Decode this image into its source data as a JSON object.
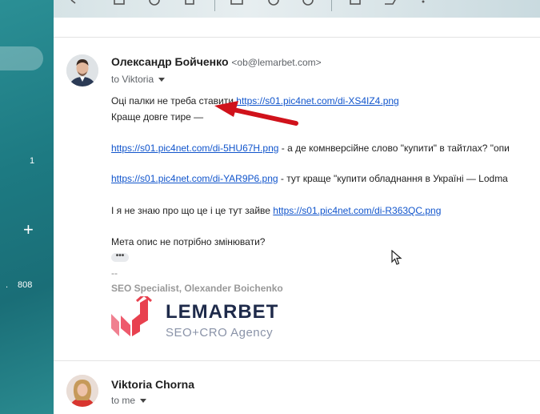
{
  "sidebar": {
    "counts": [
      "1",
      "808"
    ],
    "compose_plus": "+",
    "dot": "."
  },
  "toolbar": {
    "icons": [
      "back-arrow-icon",
      "archive-icon",
      "report-spam-icon",
      "delete-icon",
      "mark-unread-icon",
      "snooze-icon",
      "add-task-icon",
      "move-to-icon",
      "label-icon",
      "more-icon"
    ]
  },
  "message1": {
    "sender_name": "Олександр Бойченко",
    "sender_email": "<ob@lemarbet.com>",
    "to_line": "to Viktoria",
    "lines": [
      {
        "text": "Оці палки не треба ставити ",
        "link": "https://s01.pic4net.com/di-XS4IZ4.png",
        "after": ""
      },
      {
        "text": "Краще довге тире —",
        "link": "",
        "after": ""
      },
      {
        "text": "",
        "link": "https://s01.pic4net.com/di-5HU67H.png",
        "after": " - а де комнверсійне слово \"купити\" в тайтлах? \"опи"
      },
      {
        "text": "",
        "link": "https://s01.pic4net.com/di-YAR9P6.png",
        "after": " - тут краще \"купити обладнання в Україні — Lodma"
      },
      {
        "text": "І я не знаю про що це і це тут зайве ",
        "link": "https://s01.pic4net.com/di-R363QC.png",
        "after": ""
      },
      {
        "text": "Мета опис не потрібно змінювати?",
        "link": "",
        "after": ""
      }
    ],
    "ellipsis": "•••",
    "signature": {
      "dash": "--",
      "title": "SEO Specialist, Olexander Boichenko",
      "logo_word": "LEMARBET",
      "logo_tagline": "SEO+CRO Agency"
    }
  },
  "message2": {
    "sender_name": "Viktoria Chorna",
    "to_line": "to me"
  },
  "colors": {
    "sidebar": "#1d7a82",
    "link": "#1155cc",
    "arrow": "#d0121b",
    "logo_red": "#e8414f"
  }
}
